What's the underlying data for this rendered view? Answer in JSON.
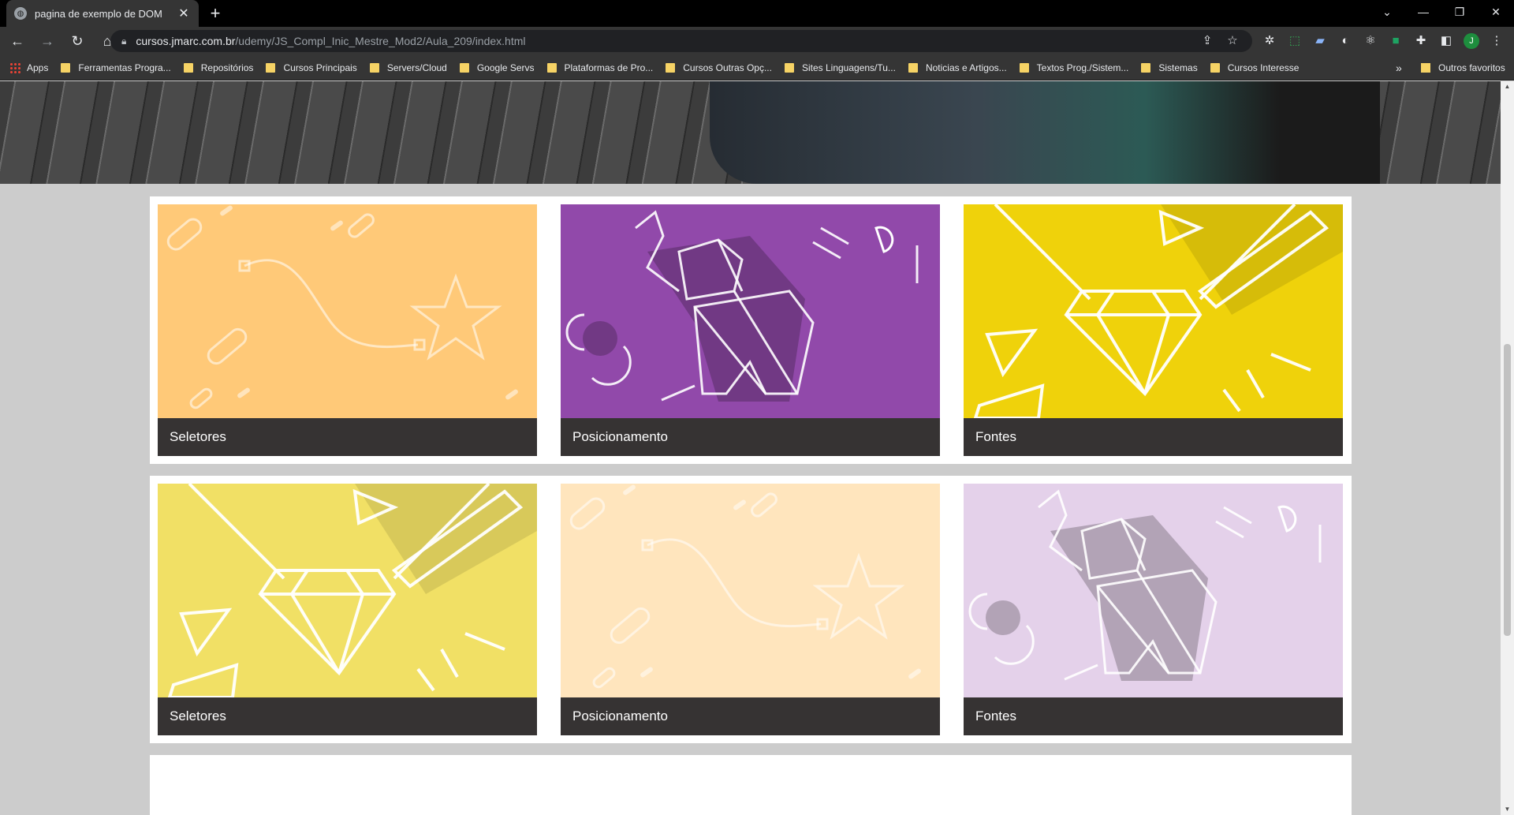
{
  "browser": {
    "tab_title": "pagina de exemplo de DOM",
    "url_host": "cursos.jmarc.com.br",
    "url_path": "/udemy/JS_Compl_Inic_Mestre_Mod2/Aula_209/index.html",
    "profile_initial": "J",
    "bookmarks": [
      {
        "label": "Apps"
      },
      {
        "label": "Ferramentas Progra..."
      },
      {
        "label": "Repositórios"
      },
      {
        "label": "Cursos Principais"
      },
      {
        "label": "Servers/Cloud"
      },
      {
        "label": "Google Servs"
      },
      {
        "label": "Plataformas de Pro..."
      },
      {
        "label": "Cursos Outras Opç..."
      },
      {
        "label": "Sites Linguagens/Tu..."
      },
      {
        "label": "Noticias e Artigos..."
      },
      {
        "label": "Textos Prog./Sistem..."
      },
      {
        "label": "Sistemas"
      },
      {
        "label": "Cursos Interesse"
      }
    ],
    "other_bookmarks": "Outros favoritos"
  },
  "cards": [
    {
      "caption": "Seletores",
      "theme": "star",
      "bg": "#ffc978",
      "opacity": 1
    },
    {
      "caption": "Posicionamento",
      "theme": "elephant",
      "bg": "#9149aa",
      "opacity": 1
    },
    {
      "caption": "Fontes",
      "theme": "diamond",
      "bg": "#efd20b",
      "opacity": 1
    },
    {
      "caption": "Seletores",
      "theme": "diamond",
      "bg": "#f1e065",
      "opacity": 1
    },
    {
      "caption": "Posicionamento",
      "theme": "star",
      "bg": "#ffe5bd",
      "opacity": 1
    },
    {
      "caption": "Fontes",
      "theme": "elephant",
      "bg": "#e4d1ea",
      "opacity": 1
    }
  ]
}
